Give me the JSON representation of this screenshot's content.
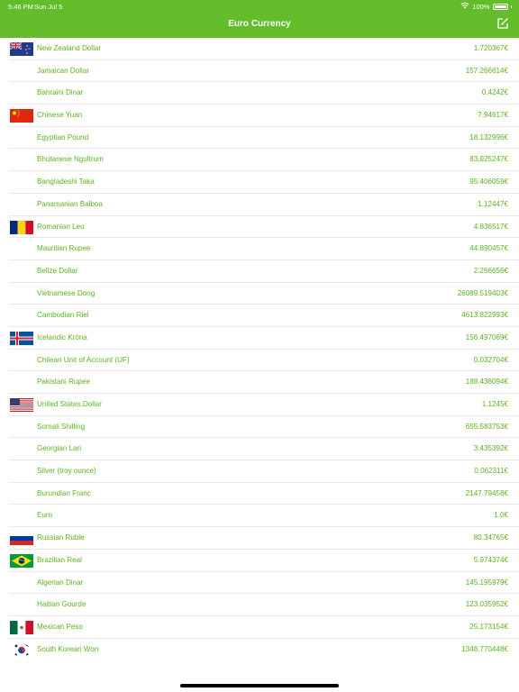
{
  "status_bar": {
    "time": "5:46 PM",
    "date": "Sun Jul 5",
    "battery": "100%"
  },
  "header": {
    "title": "Euro Currency"
  },
  "currencies": [
    {
      "flag": "new-zealand-flag-icon",
      "name": "New Zealand Dollar",
      "value": "1.720367€"
    },
    {
      "flag": "",
      "name": "Jamaican Dollar",
      "value": "157.266614€"
    },
    {
      "flag": "",
      "name": "Bahraini Dinar",
      "value": "0.4242€"
    },
    {
      "flag": "china-flag-icon",
      "name": "Chinese Yuan",
      "value": "7.94617€"
    },
    {
      "flag": "",
      "name": "Egyptian Pound",
      "value": "18.132996€"
    },
    {
      "flag": "",
      "name": "Bhutanese Ngultrum",
      "value": "83.925247€"
    },
    {
      "flag": "",
      "name": "Bangladeshi Taka",
      "value": "95.406059€"
    },
    {
      "flag": "",
      "name": "Panamanian Balboa",
      "value": "1.12447€"
    },
    {
      "flag": "romania-flag-icon",
      "name": "Romanian Leu",
      "value": "4.836517€"
    },
    {
      "flag": "",
      "name": "Mauritian Rupee",
      "value": "44.890457€"
    },
    {
      "flag": "",
      "name": "Belize Dollar",
      "value": "2.266656€"
    },
    {
      "flag": "",
      "name": "Vietnamese Dong",
      "value": "26089.519403€"
    },
    {
      "flag": "",
      "name": "Cambodian Riel",
      "value": "4613.822993€"
    },
    {
      "flag": "iceland-flag-icon",
      "name": "Icelandic Króna",
      "value": "156.497069€"
    },
    {
      "flag": "",
      "name": "Chilean Unit of Account (UF)",
      "value": "0.032704€"
    },
    {
      "flag": "",
      "name": "Pakistani Rupee",
      "value": "188.438094€"
    },
    {
      "flag": "usa-flag-icon",
      "name": "United States Dollar",
      "value": "1.1245€"
    },
    {
      "flag": "",
      "name": "Somali Shilling",
      "value": "655.583753€"
    },
    {
      "flag": "",
      "name": "Georgian Lari",
      "value": "3.435392€"
    },
    {
      "flag": "",
      "name": "Silver (troy ounce)",
      "value": "0.062311€"
    },
    {
      "flag": "",
      "name": "Burundian Franc",
      "value": "2147.79458€"
    },
    {
      "flag": "",
      "name": "Euro",
      "value": "1.0€"
    },
    {
      "flag": "russia-flag-icon",
      "name": "Russian Ruble",
      "value": "80.34765€"
    },
    {
      "flag": "brazil-flag-icon",
      "name": "Brazilian Real",
      "value": "5.974374€"
    },
    {
      "flag": "",
      "name": "Algerian Dinar",
      "value": "145.195979€"
    },
    {
      "flag": "",
      "name": "Haitian Gourde",
      "value": "123.035952€"
    },
    {
      "flag": "mexico-flag-icon",
      "name": "Mexican Peso",
      "value": "25.173154€"
    },
    {
      "flag": "south-korea-flag-icon",
      "name": "South Korean Won",
      "value": "1348.770448€"
    }
  ],
  "colors": {
    "header": "#63bd2a",
    "text": "#5bb31f",
    "separator": "#e8e8e8"
  }
}
